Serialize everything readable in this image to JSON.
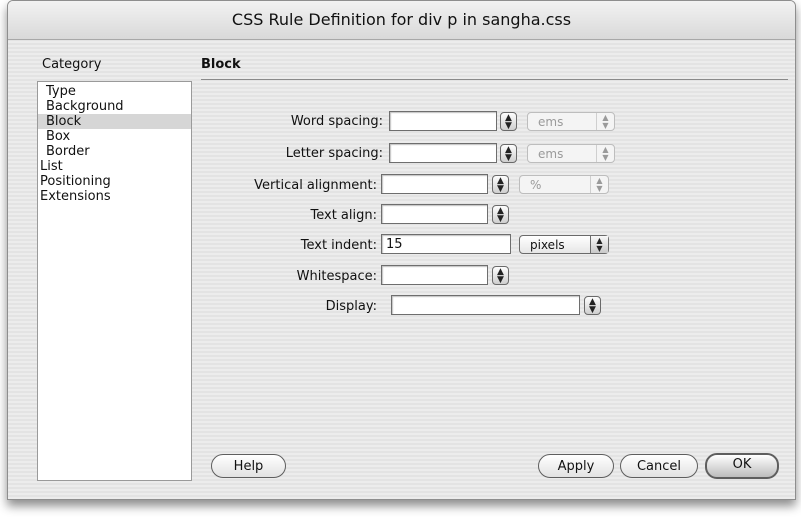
{
  "window": {
    "title": "CSS Rule Definition for div p in sangha.css"
  },
  "category": {
    "heading": "Category",
    "items": [
      "Type",
      "Background",
      "Block",
      "Box",
      "Border",
      "List",
      "Positioning",
      "Extensions"
    ],
    "selected": "Block"
  },
  "panel": {
    "heading": "Block"
  },
  "form": {
    "word_spacing": {
      "label": "Word spacing:",
      "value": "",
      "unit": "ems"
    },
    "letter_spacing": {
      "label": "Letter spacing:",
      "value": "",
      "unit": "ems"
    },
    "vertical_alignment": {
      "label": "Vertical alignment:",
      "value": "",
      "unit": "%"
    },
    "text_align": {
      "label": "Text align:",
      "value": ""
    },
    "text_indent": {
      "label": "Text indent:",
      "value": "15",
      "unit": "pixels"
    },
    "whitespace": {
      "label": "Whitespace:",
      "value": ""
    },
    "display": {
      "label": "Display:",
      "value": ""
    }
  },
  "buttons": {
    "help": "Help",
    "apply": "Apply",
    "cancel": "Cancel",
    "ok": "OK"
  }
}
